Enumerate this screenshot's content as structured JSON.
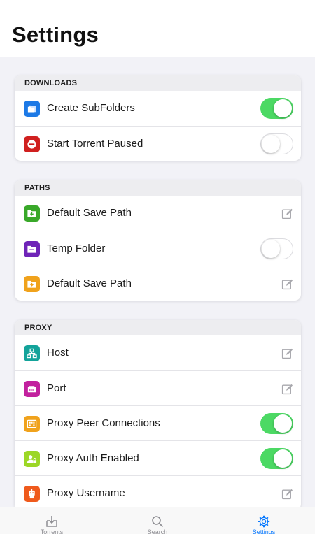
{
  "header": {
    "title": "Settings"
  },
  "sections": {
    "downloads": {
      "title": "DOWNLOADS",
      "rows": [
        {
          "label": "Create SubFolders",
          "icon": "folders-icon",
          "icon_color": "#1c79e6",
          "control": "toggle",
          "on": true
        },
        {
          "label": "Start Torrent Paused",
          "icon": "no-entry-icon",
          "icon_color": "#d0201f",
          "control": "toggle",
          "on": false
        }
      ]
    },
    "paths": {
      "title": "PATHS",
      "rows": [
        {
          "label": "Default Save Path",
          "icon": "folder-download-icon",
          "icon_color": "#39a829",
          "control": "edit"
        },
        {
          "label": "Temp Folder",
          "icon": "folder-minus-icon",
          "icon_color": "#6f24b8",
          "control": "toggle",
          "on": false
        },
        {
          "label": "Default Save Path",
          "icon": "folder-download-icon",
          "icon_color": "#f0a21c",
          "control": "edit"
        }
      ]
    },
    "proxy": {
      "title": "PROXY",
      "rows": [
        {
          "label": "Host",
          "icon": "network-icon",
          "icon_color": "#13a39a",
          "control": "edit"
        },
        {
          "label": "Port",
          "icon": "ethernet-port-icon",
          "icon_color": "#c2209e",
          "control": "edit"
        },
        {
          "label": "Proxy Peer Connections",
          "icon": "connections-icon",
          "icon_color": "#f0a21c",
          "control": "toggle",
          "on": true
        },
        {
          "label": "Proxy Auth Enabled",
          "icon": "user-lock-icon",
          "icon_color": "#9cd726",
          "control": "toggle",
          "on": true
        },
        {
          "label": "Proxy Username",
          "icon": "user-badge-icon",
          "icon_color": "#ef5a1c",
          "control": "edit"
        }
      ]
    }
  },
  "tabbar": {
    "tabs": [
      {
        "label": "Torrents",
        "icon": "download-tray-icon",
        "active": false
      },
      {
        "label": "Search",
        "icon": "search-icon",
        "active": false
      },
      {
        "label": "Settings",
        "icon": "gear-icon",
        "active": true
      }
    ]
  },
  "colors": {
    "accent": "#0a7aff",
    "toggle_on": "#4cd964",
    "background": "#f2f2f7"
  }
}
